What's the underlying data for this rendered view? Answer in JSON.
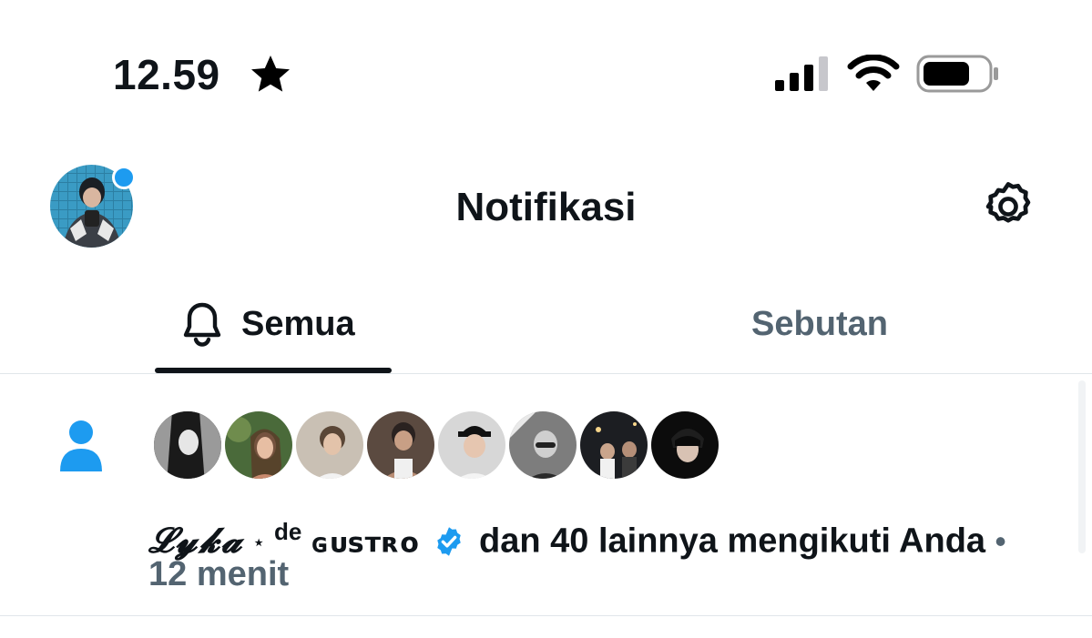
{
  "status_bar": {
    "time": "12.59",
    "icons": [
      "star-icon",
      "signal-icon",
      "wifi-icon",
      "battery-icon"
    ]
  },
  "header": {
    "title": "Notifikasi",
    "avatar": "profile-avatar",
    "settings_icon": "gear-icon"
  },
  "tabs": [
    {
      "label": "Semua",
      "icon": "bell-icon",
      "active": true
    },
    {
      "label": "Sebutan",
      "active": false
    }
  ],
  "notification": {
    "icon": "person-icon",
    "follower_avatars_count": 8,
    "name1": "𝓛𝔂𝓴𝓪",
    "sparkle": "⋆",
    "name2_prefix": "de",
    "name2": "ɢᴜꜱᴛʀᴏ",
    "text": "dan 40 lainnya mengikuti Anda",
    "separator": "•",
    "time": "12 menit"
  },
  "colors": {
    "accent": "#1d9bf0",
    "text_primary": "#0f1419",
    "text_secondary": "#536471",
    "divider": "#e1e6ea"
  }
}
